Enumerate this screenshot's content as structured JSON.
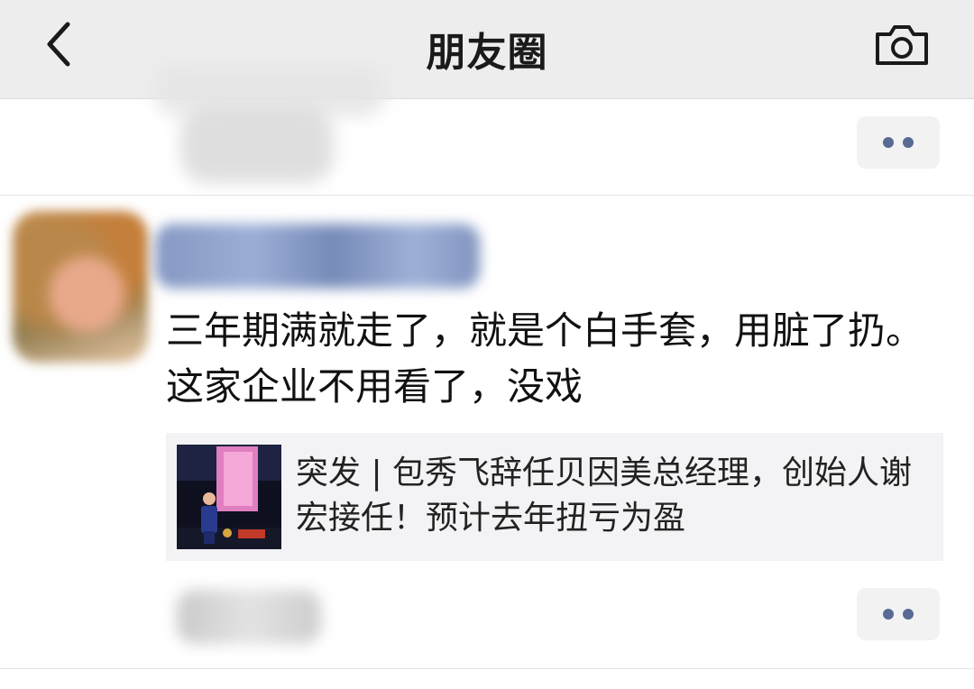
{
  "header": {
    "title": "朋友圈",
    "back_icon": "chevron-left-icon",
    "camera_icon": "camera-icon",
    "background": "#ededed"
  },
  "posts": [
    {
      "more_icon": "more-dots-icon"
    },
    {
      "text": "三年期满就走了，就是个白手套，用脏了扔。这家企业不用看了，没戏",
      "share": {
        "title": "突发 | 包秀飞辞任贝因美总经理，创始人谢宏接任！预计去年扭亏为盈"
      },
      "more_icon": "more-dots-icon"
    }
  ],
  "colors": {
    "link_blue": "#576b95",
    "card_bg": "#f3f3f5"
  }
}
